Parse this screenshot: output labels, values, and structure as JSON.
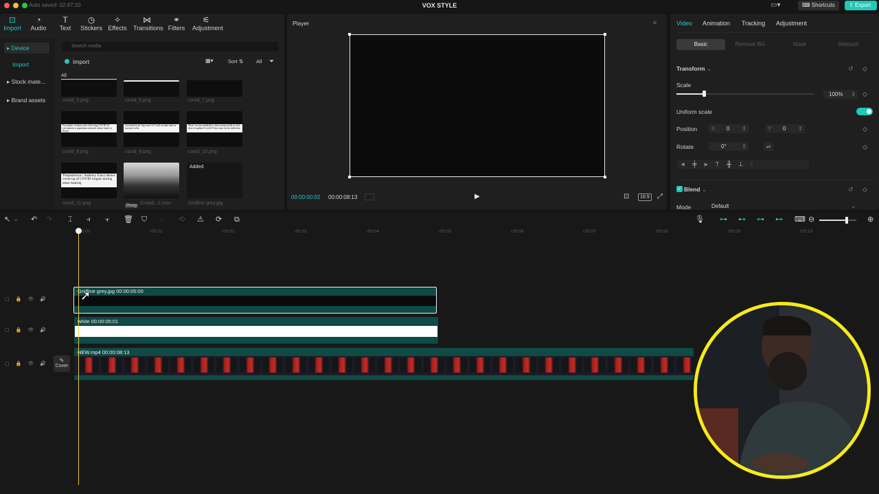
{
  "titlebar": {
    "autosave": "Auto saved: 02:47:10",
    "title": "VOX STYLE",
    "shortcuts_label": "Shortcuts",
    "export_label": "Export",
    "accent": "#1fc8b8"
  },
  "toolbar": {
    "tabs": [
      {
        "label": "Import",
        "icon": "import-icon"
      },
      {
        "label": "Audio",
        "icon": "audio-icon"
      },
      {
        "label": "Text",
        "icon": "text-icon"
      },
      {
        "label": "Stickers",
        "icon": "stickers-icon"
      },
      {
        "label": "Effects",
        "icon": "effects-icon"
      },
      {
        "label": "Transitions",
        "icon": "transitions-icon"
      },
      {
        "label": "Filters",
        "icon": "filters-icon"
      },
      {
        "label": "Adjustment",
        "icon": "adjustment-icon"
      }
    ]
  },
  "sidebar": {
    "items": [
      "Device",
      "Import",
      "Stock mate...",
      "Brand assets"
    ]
  },
  "media": {
    "search_placeholder": "Search media",
    "import_label": "Import",
    "sort_label": "Sort",
    "all_label": "All",
    "section_label": "All",
    "items": [
      {
        "name": "covid_5.png",
        "kind": "dark"
      },
      {
        "name": "covid_6.png",
        "kind": "white-line"
      },
      {
        "name": "covid_7.png",
        "kind": "dark"
      },
      {
        "name": "covid_8.png",
        "kind": "headline",
        "headline": "Psychiatric sickness rises following COVID-19 vaccination, a population research cohort study in Korea"
      },
      {
        "name": "covid_9.png",
        "kind": "headline",
        "headline": "Australia hit by 'big wave' of Covid at same time as increase in flu"
      },
      {
        "name": "covid_10.png",
        "kind": "headline",
        "headline": "Pfizer vaccine antibodies wane unexpectedly as 2nd dose of updated Covid-19 shot may not be sufficient"
      },
      {
        "name": "covid_11.png",
        "kind": "headline-big",
        "headline": "'Preposterous': Anthony Fauci denies cover-up of COVID origins during tense hearing"
      },
      {
        "name": "Crowd...2.mov",
        "kind": "crowd",
        "badge": "Proxy"
      },
      {
        "name": "Gridline grey.jpg",
        "kind": "added",
        "badge": "Added"
      }
    ]
  },
  "player": {
    "title": "Player",
    "current_time": "00:00:00:02",
    "total_time": "00:00:08:13",
    "ratio": "16:9"
  },
  "inspector": {
    "tabs": [
      "Video",
      "Animation",
      "Tracking",
      "Adjustment"
    ],
    "segments": [
      "Basic",
      "Remove BG",
      "Mask",
      "Retouch"
    ],
    "transform_label": "Transform",
    "scale_label": "Scale",
    "scale_value": "100%",
    "scale_fraction": 0.2,
    "uniform_label": "Uniform scale",
    "position_label": "Position",
    "x_label": "X",
    "x_value": "0",
    "y_label": "Y",
    "y_value": "0",
    "rotate_label": "Rotate",
    "rotate_value": "0°",
    "blend_label": "Blend",
    "mode_label": "Mode",
    "mode_value": "Default"
  },
  "timeline": {
    "ticks": [
      "00:00",
      "00:01",
      "00:02",
      "00:03",
      "00:04",
      "00:05",
      "00:06",
      "00:07",
      "00:08",
      "00:09",
      "00:10"
    ],
    "cover_label": "Cover",
    "clips": [
      {
        "label": "Gridline grey.jpg   00:00:05:00"
      },
      {
        "label": "white   00:00:05:01"
      },
      {
        "label": "NEW.mp4   00:00:08:13"
      }
    ],
    "zoom_fraction": 0.7
  }
}
